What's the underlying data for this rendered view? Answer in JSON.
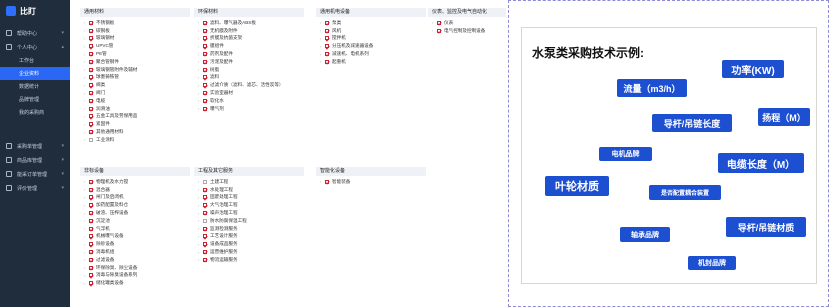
{
  "sidebar": {
    "logo": "比盯",
    "items": [
      {
        "label": "帮助中心"
      },
      {
        "label": "个人中心"
      }
    ],
    "subs": [
      "工作台",
      "企业资料",
      "数据统计",
      "品牌管理",
      "我的采购商"
    ],
    "active_sub": 1,
    "items2": [
      {
        "label": "采购单管理"
      },
      {
        "label": "商品库管理"
      },
      {
        "label": "能采订单管理"
      },
      {
        "label": "评价管理"
      }
    ]
  },
  "categories": [
    {
      "title": "通用材料",
      "items": [
        "不锈钢板",
        "碳钢板",
        "玻璃钢材",
        "UPVC管",
        "PE管",
        "聚合管钢件",
        "玻璃钢管附件及辅材",
        "球墨铸铁管",
        "阀类",
        "阀门",
        "电缆",
        "润滑油",
        "五金工具及劳保用品",
        "紧固件",
        "其他通用材料",
        "工业涂料"
      ],
      "checked": [
        1,
        1,
        1,
        1,
        1,
        1,
        1,
        1,
        1,
        1,
        1,
        1,
        1,
        1,
        1,
        0
      ]
    },
    {
      "title": "环保材料",
      "items": [
        "滤料、曝气器及ABS板",
        "无机膜及附件",
        "折膜及抗菌支架",
        "膜组件",
        "药剂及配件",
        "污泥及配件",
        "树脂",
        "滤料",
        "过滤介质（滤料、滤芯、活性炭等）",
        "实验室器材",
        "软化水",
        "曝气剂"
      ],
      "checked": [
        1,
        1,
        1,
        1,
        1,
        1,
        1,
        1,
        1,
        1,
        1,
        1
      ]
    },
    {
      "title": "通用机电设备",
      "items": [
        "泵类",
        "风机",
        "搅拌机",
        "分压机及减速器设备",
        "减速机、电机系列",
        "起重机"
      ],
      "checked": [
        1,
        1,
        1,
        1,
        1,
        1
      ]
    },
    {
      "title": "仪表、监控及电气自动化",
      "items": [
        "仪表",
        "电气控制及控制设备"
      ],
      "checked": [
        1,
        1
      ]
    },
    {
      "title": "非标设备",
      "items": [
        "物理机及水力搅",
        "混合器",
        "闸门及启闭机",
        "加药配置及料仓",
        "破渣、压榨设备",
        "沉淀池",
        "气浮机",
        "机械曝气设备",
        "除砂设备",
        "消毒机组",
        "过滤设备",
        "环保除臭、除尘设备",
        "消毒与除臭设备系列",
        "储化罐类设备"
      ],
      "checked": [
        1,
        1,
        1,
        1,
        1,
        1,
        1,
        1,
        1,
        1,
        1,
        1,
        1,
        1
      ]
    },
    {
      "title": "工程及其它服务",
      "items": [
        "土建工程",
        "水处理工程",
        "固废处理工程",
        "大气治理工程",
        "噪声治理工程",
        "防水防腐保温工程",
        "监测检测服务",
        "工艺设计服务",
        "设备成品服务",
        "运营维护服务",
        "物流运输服务"
      ],
      "checked": [
        0,
        1,
        1,
        1,
        1,
        0,
        1,
        1,
        1,
        1,
        1
      ]
    },
    {
      "title": "智能化设备",
      "items": [
        "智能装备"
      ],
      "checked": [
        1
      ]
    }
  ],
  "panel": {
    "title": "水泵类采购技术示例:",
    "tags": [
      "流量（m3/h）",
      "功率(KW)",
      "导杆/吊链长度",
      "扬程（M）",
      "电机品牌",
      "电缆长度（M）",
      "叶轮材质",
      "是否配置耦合装置",
      "导杆/吊链材质",
      "轴承品牌",
      "机封品牌"
    ]
  }
}
